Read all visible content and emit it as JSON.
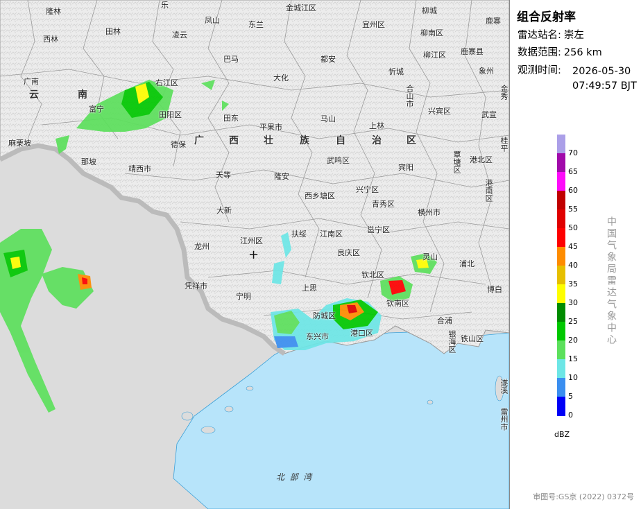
{
  "product": {
    "title": "组合反射率",
    "station_key": "雷达站名:",
    "station_value": "崇左",
    "range_key": "数据范围:",
    "range_value": "256 km",
    "time_key": "观测时间:",
    "time_date": "2026-05-30",
    "time_clock": "07:49:57 BJT"
  },
  "legend": {
    "unit": "dBZ",
    "levels": [
      {
        "value": "70",
        "color": "#ab9fe8"
      },
      {
        "value": "65",
        "color": "#a10aaa"
      },
      {
        "value": "60",
        "color": "#fe0afa"
      },
      {
        "value": "55",
        "color": "#c00000"
      },
      {
        "value": "50",
        "color": "#e00000"
      },
      {
        "value": "45",
        "color": "#fe0000"
      },
      {
        "value": "40",
        "color": "#fe8c00"
      },
      {
        "value": "35",
        "color": "#e6bf00"
      },
      {
        "value": "30",
        "color": "#fefe00"
      },
      {
        "value": "25",
        "color": "#008c00"
      },
      {
        "value": "20",
        "color": "#00c800"
      },
      {
        "value": "15",
        "color": "#5ce05c"
      },
      {
        "value": "10",
        "color": "#6de6e6"
      },
      {
        "value": "5",
        "color": "#3a8ef0"
      },
      {
        "value": "0",
        "color": "#0000f6"
      }
    ]
  },
  "agency": "中国气象局雷达气象中心",
  "review_number": "审图号:GS京 (2022) 0372号",
  "map": {
    "radar_site_symbol": "+",
    "sea_label": "北  部  湾",
    "region_labels": {
      "yunnan_1": "云",
      "yunnan_2": "南",
      "guangxi_1": "广",
      "guangxi_2": "西",
      "guangxi_3": "壮",
      "guangxi_4": "族",
      "guangxi_5": "自",
      "guangxi_6": "治",
      "guangxi_7": "区"
    },
    "places": {
      "longlin": "隆林",
      "le": "乐",
      "jinchengjiang": "金城江区",
      "liucheng": "柳城",
      "luzhai": "鹿寨",
      "xilin": "西林",
      "tianlin": "田林",
      "lingyun": "凌云",
      "fengshan": "凤山",
      "donglan": "东兰",
      "yizhou": "宜州区",
      "liunan": "柳南区",
      "bama": "巴马",
      "duan": "都安",
      "liujiang": "柳江区",
      "luzhai2": "鹿寨县",
      "xincheng": "忻城",
      "heshan": "合山市",
      "xiangzhou": "象州",
      "guangnan": "广南",
      "youjiang": "右江区",
      "dahua": "大化",
      "funing": "富宁",
      "tiandong": "田东",
      "tianyang": "田阳区",
      "pingguo": "平果市",
      "mashan": "马山",
      "shanglin": "上林",
      "xingbin": "兴宾区",
      "wuxuan": "武宣",
      "malipo": "麻栗坡",
      "debao": "德保",
      "napo": "那坡",
      "jingxi": "靖西市",
      "tiandeng": "天等",
      "longan": "隆安",
      "wuming": "武鸣区",
      "binyang": "宾阳",
      "guigang": "覃塘区",
      "gangbei": "港北区",
      "gangnan": "港南区",
      "xixiangtang": "西乡塘区",
      "xingning": "兴宁区",
      "daxin": "大新",
      "qingxiu": "青秀区",
      "hengzhou": "横州市",
      "longzhou": "龙州",
      "jiangzhou": "江州区",
      "fusui": "扶绥",
      "jiangnan": "江南区",
      "yongning": "邕宁区",
      "liangqing": "良庆区",
      "lingshan": "灵山",
      "pubei": "浦北",
      "pingxiang": "凭祥市",
      "ningming": "宁明",
      "shangsi": "上思",
      "qinbei": "钦北区",
      "qinnan": "钦南区",
      "bobai": "博白",
      "fangcheng": "防城区",
      "hepu": "合浦",
      "dongxing": "东兴市",
      "gangkou": "港口区",
      "yinhai": "银海区",
      "tieshan": "铁山区",
      "gui": "桂平",
      "jin": "金秀",
      "wuxi": "遂溪",
      "leizhou": "雷州市",
      "guang": "广南"
    }
  }
}
